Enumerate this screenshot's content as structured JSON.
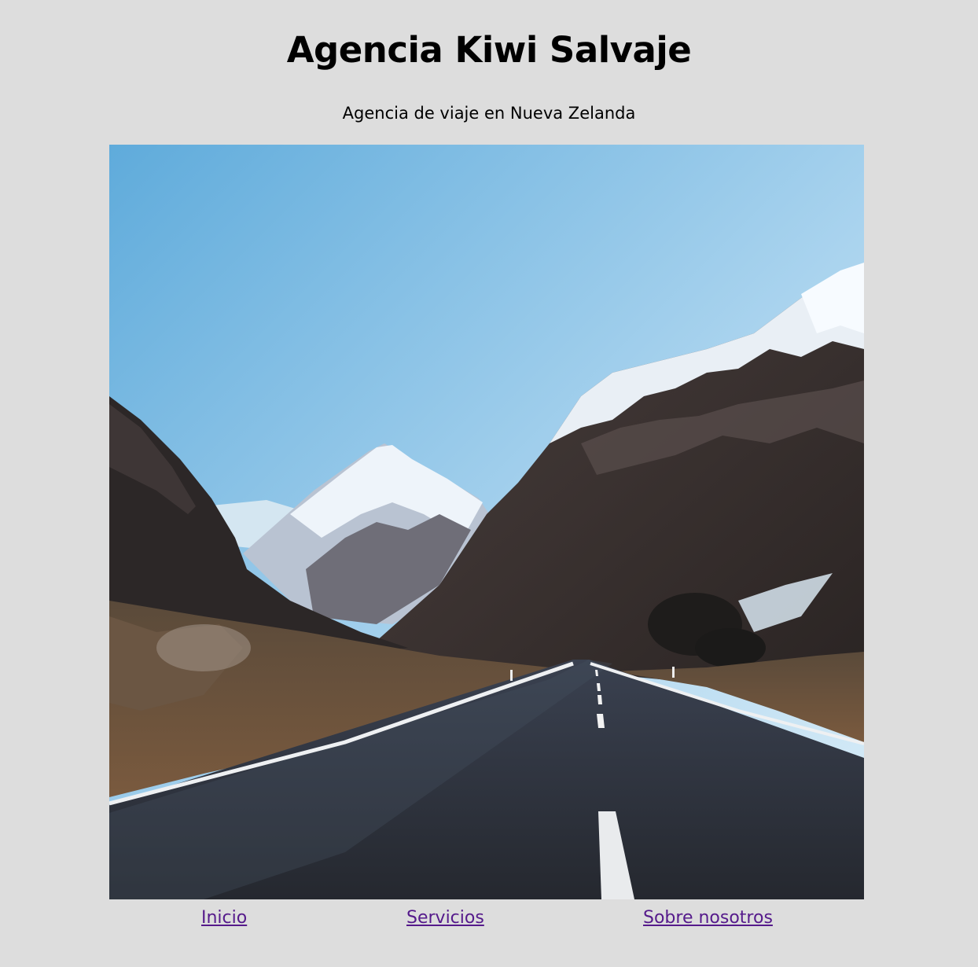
{
  "header": {
    "title": "Agencia Kiwi Salvaje",
    "subtitle": "Agencia de viaje en Nueva Zelanda"
  },
  "hero": {
    "subject": "mountain-road-photo"
  },
  "nav": {
    "items": [
      {
        "label": "Inicio"
      },
      {
        "label": "Servicios"
      },
      {
        "label": "Sobre nosotros"
      }
    ]
  },
  "colors": {
    "background": "#dddddd",
    "link": "#551a8b",
    "text": "#000000"
  }
}
